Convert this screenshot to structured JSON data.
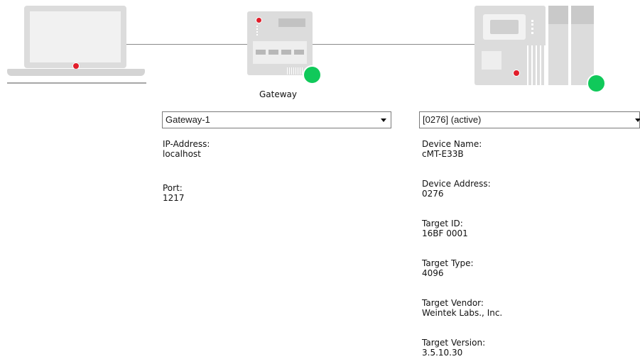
{
  "gateway": {
    "caption": "Gateway",
    "selected": "Gateway-1",
    "fields": [
      {
        "label": "IP-Address:",
        "value": "localhost"
      },
      {
        "label": "Port:",
        "value": "1217"
      }
    ],
    "status_color": "#10c95a"
  },
  "device": {
    "selected": "[0276] (active)",
    "fields": [
      {
        "label": "Device Name:",
        "value": "cMT-E33B"
      },
      {
        "label": "Device Address:",
        "value": "0276"
      },
      {
        "label": "Target ID:",
        "value": "16BF 0001"
      },
      {
        "label": "Target Type:",
        "value": "4096"
      },
      {
        "label": "Target Vendor:",
        "value": "Weintek Labs., Inc."
      },
      {
        "label": "Target Version:",
        "value": "3.5.10.30"
      }
    ],
    "status_color": "#10c95a"
  },
  "icons": {
    "computer": "laptop-icon",
    "gateway": "gateway-device-icon",
    "plc": "plc-device-icon",
    "status": "status-online-icon"
  },
  "colors": {
    "status_ok": "#10c95a",
    "led_red": "#e11d2a",
    "device_gray": "#dcdcdc"
  }
}
